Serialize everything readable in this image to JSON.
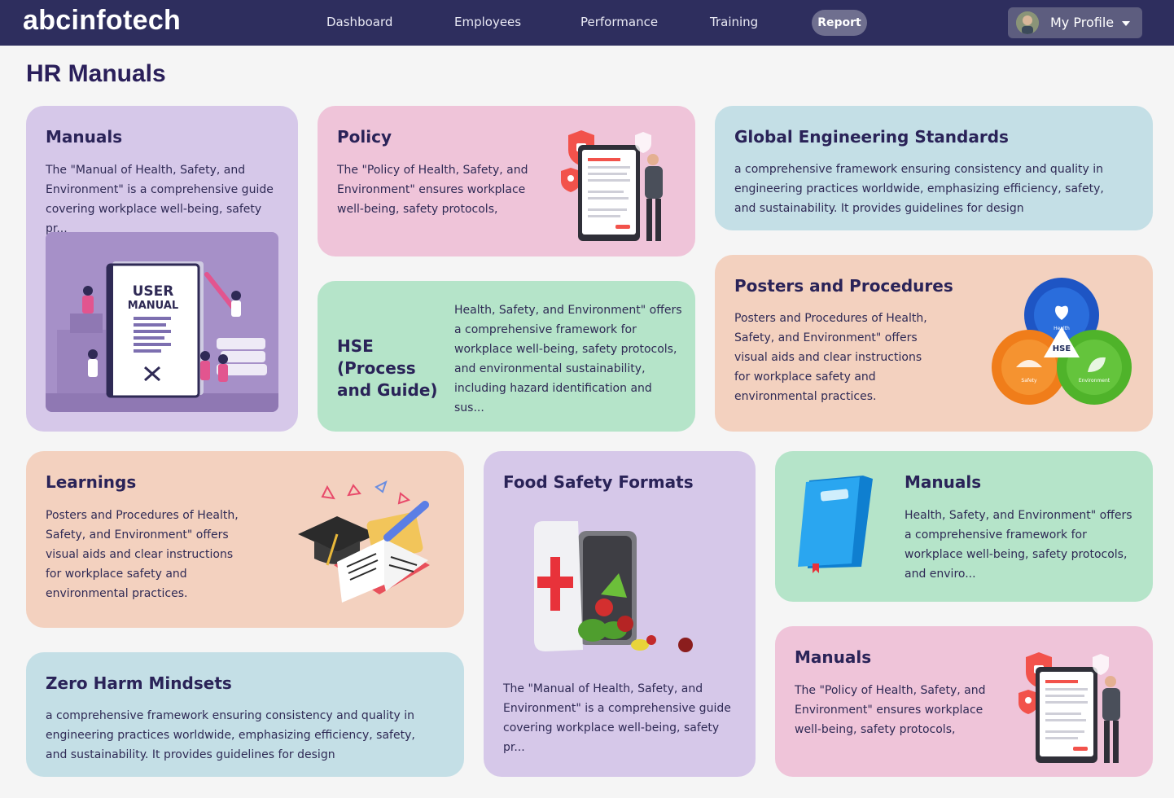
{
  "nav": {
    "logo": "abcinfotech",
    "links": [
      "Dashboard",
      "Employees",
      "Performance",
      "Training"
    ],
    "active": "Report",
    "profile_label": "My Profile"
  },
  "page": {
    "title": "HR Manuals"
  },
  "cards": {
    "manuals1": {
      "title": "Manuals",
      "desc": "The \"Manual of Health, Safety, and Environment\" is a comprehensive guide covering workplace well-being, safety pr...",
      "image_text": "USER MANUAL"
    },
    "policy": {
      "title": "Policy",
      "desc": "The \"Policy of Health, Safety, and Environment\" ensures workplace well-being, safety protocols,"
    },
    "global": {
      "title": "Global Engineering Standards",
      "desc": "a comprehensive framework ensuring consistency and quality in engineering practices worldwide, emphasizing efficiency, safety, and sustainability. It provides guidelines for design"
    },
    "hse": {
      "title": "HSE (Process and Guide)",
      "desc": "Health, Safety, and Environment\" offers a comprehensive framework for workplace well-being, safety protocols, and environmental sustainability, including hazard identification and sus..."
    },
    "posters": {
      "title": "Posters and Procedures",
      "desc": "Posters and Procedures of Health, Safety, and Environment\" offers visual aids and clear instructions for workplace safety and environmental practices.",
      "diagram": {
        "center": "HSE",
        "health": "Health",
        "safety": "Safety",
        "environment": "Environment"
      }
    },
    "learnings": {
      "title": "Learnings",
      "desc": "Posters and Procedures of Health, Safety, and Environment\" offers visual aids and clear instructions for workplace safety and environmental practices."
    },
    "food": {
      "title": "Food Safety Formats",
      "desc": "The \"Manual of Health, Safety, and Environment\" is a comprehensive guide covering workplace well-being, safety pr..."
    },
    "manuals2": {
      "title": "Manuals",
      "desc": "Health, Safety, and Environment\" offers a comprehensive framework for workplace well-being, safety protocols, and enviro..."
    },
    "zero": {
      "title": "Zero Harm Mindsets",
      "desc": "a comprehensive framework ensuring consistency and quality in engineering practices worldwide, emphasizing efficiency, safety, and sustainability. It provides guidelines for design"
    },
    "manuals3": {
      "title": "Manuals",
      "desc": "The \"Policy of Health, Safety, and Environment\" ensures workplace well-being, safety protocols,"
    }
  },
  "colors": {
    "nav_bg": "#2e2e5e",
    "purple": "#d6c8e9",
    "pink": "#efc4d9",
    "blue": "#c4dfe6",
    "green": "#b5e4c9",
    "peach": "#f3d1bf",
    "title": "#2a2358"
  }
}
